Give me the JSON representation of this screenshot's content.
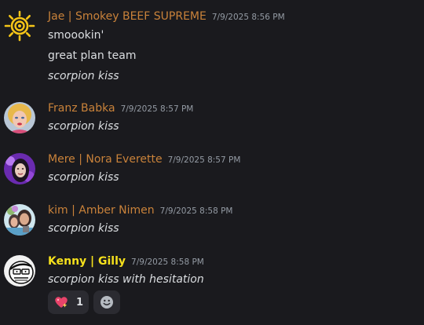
{
  "messages": [
    {
      "username": "Jae | Smokey BEEF SUPREME",
      "timestamp": "7/9/2025 8:56 PM",
      "lines": [
        "smoookin'",
        "great plan team",
        "scorpion kiss"
      ],
      "avatar": "sun-avatar"
    },
    {
      "username": "Franz Babka",
      "timestamp": "7/9/2025 8:57 PM",
      "lines": [
        "scorpion kiss"
      ],
      "avatar": "franz-avatar"
    },
    {
      "username": "Mere | Nora Everette",
      "timestamp": "7/9/2025 8:57 PM",
      "lines": [
        "scorpion kiss"
      ],
      "avatar": "mere-avatar"
    },
    {
      "username": "kim | Amber Nimen",
      "timestamp": "7/9/2025 8:58 PM",
      "lines": [
        "scorpion kiss"
      ],
      "avatar": "kim-avatar"
    },
    {
      "username": "Kenny | Gilly",
      "timestamp": "7/9/2025 8:58 PM",
      "lines": [
        "scorpion kiss with hesitation"
      ],
      "avatar": "kenny-avatar"
    }
  ],
  "reactions": [
    {
      "icon": "sparkling-heart-icon",
      "count": "1"
    }
  ],
  "add_reaction_icon": "smiley-icon",
  "colors": {
    "background": "#1a1a1e",
    "username": "#c9823a",
    "username_highlight": "#f6e11c",
    "text": "#dbdee1",
    "timestamp": "#949ba4"
  }
}
